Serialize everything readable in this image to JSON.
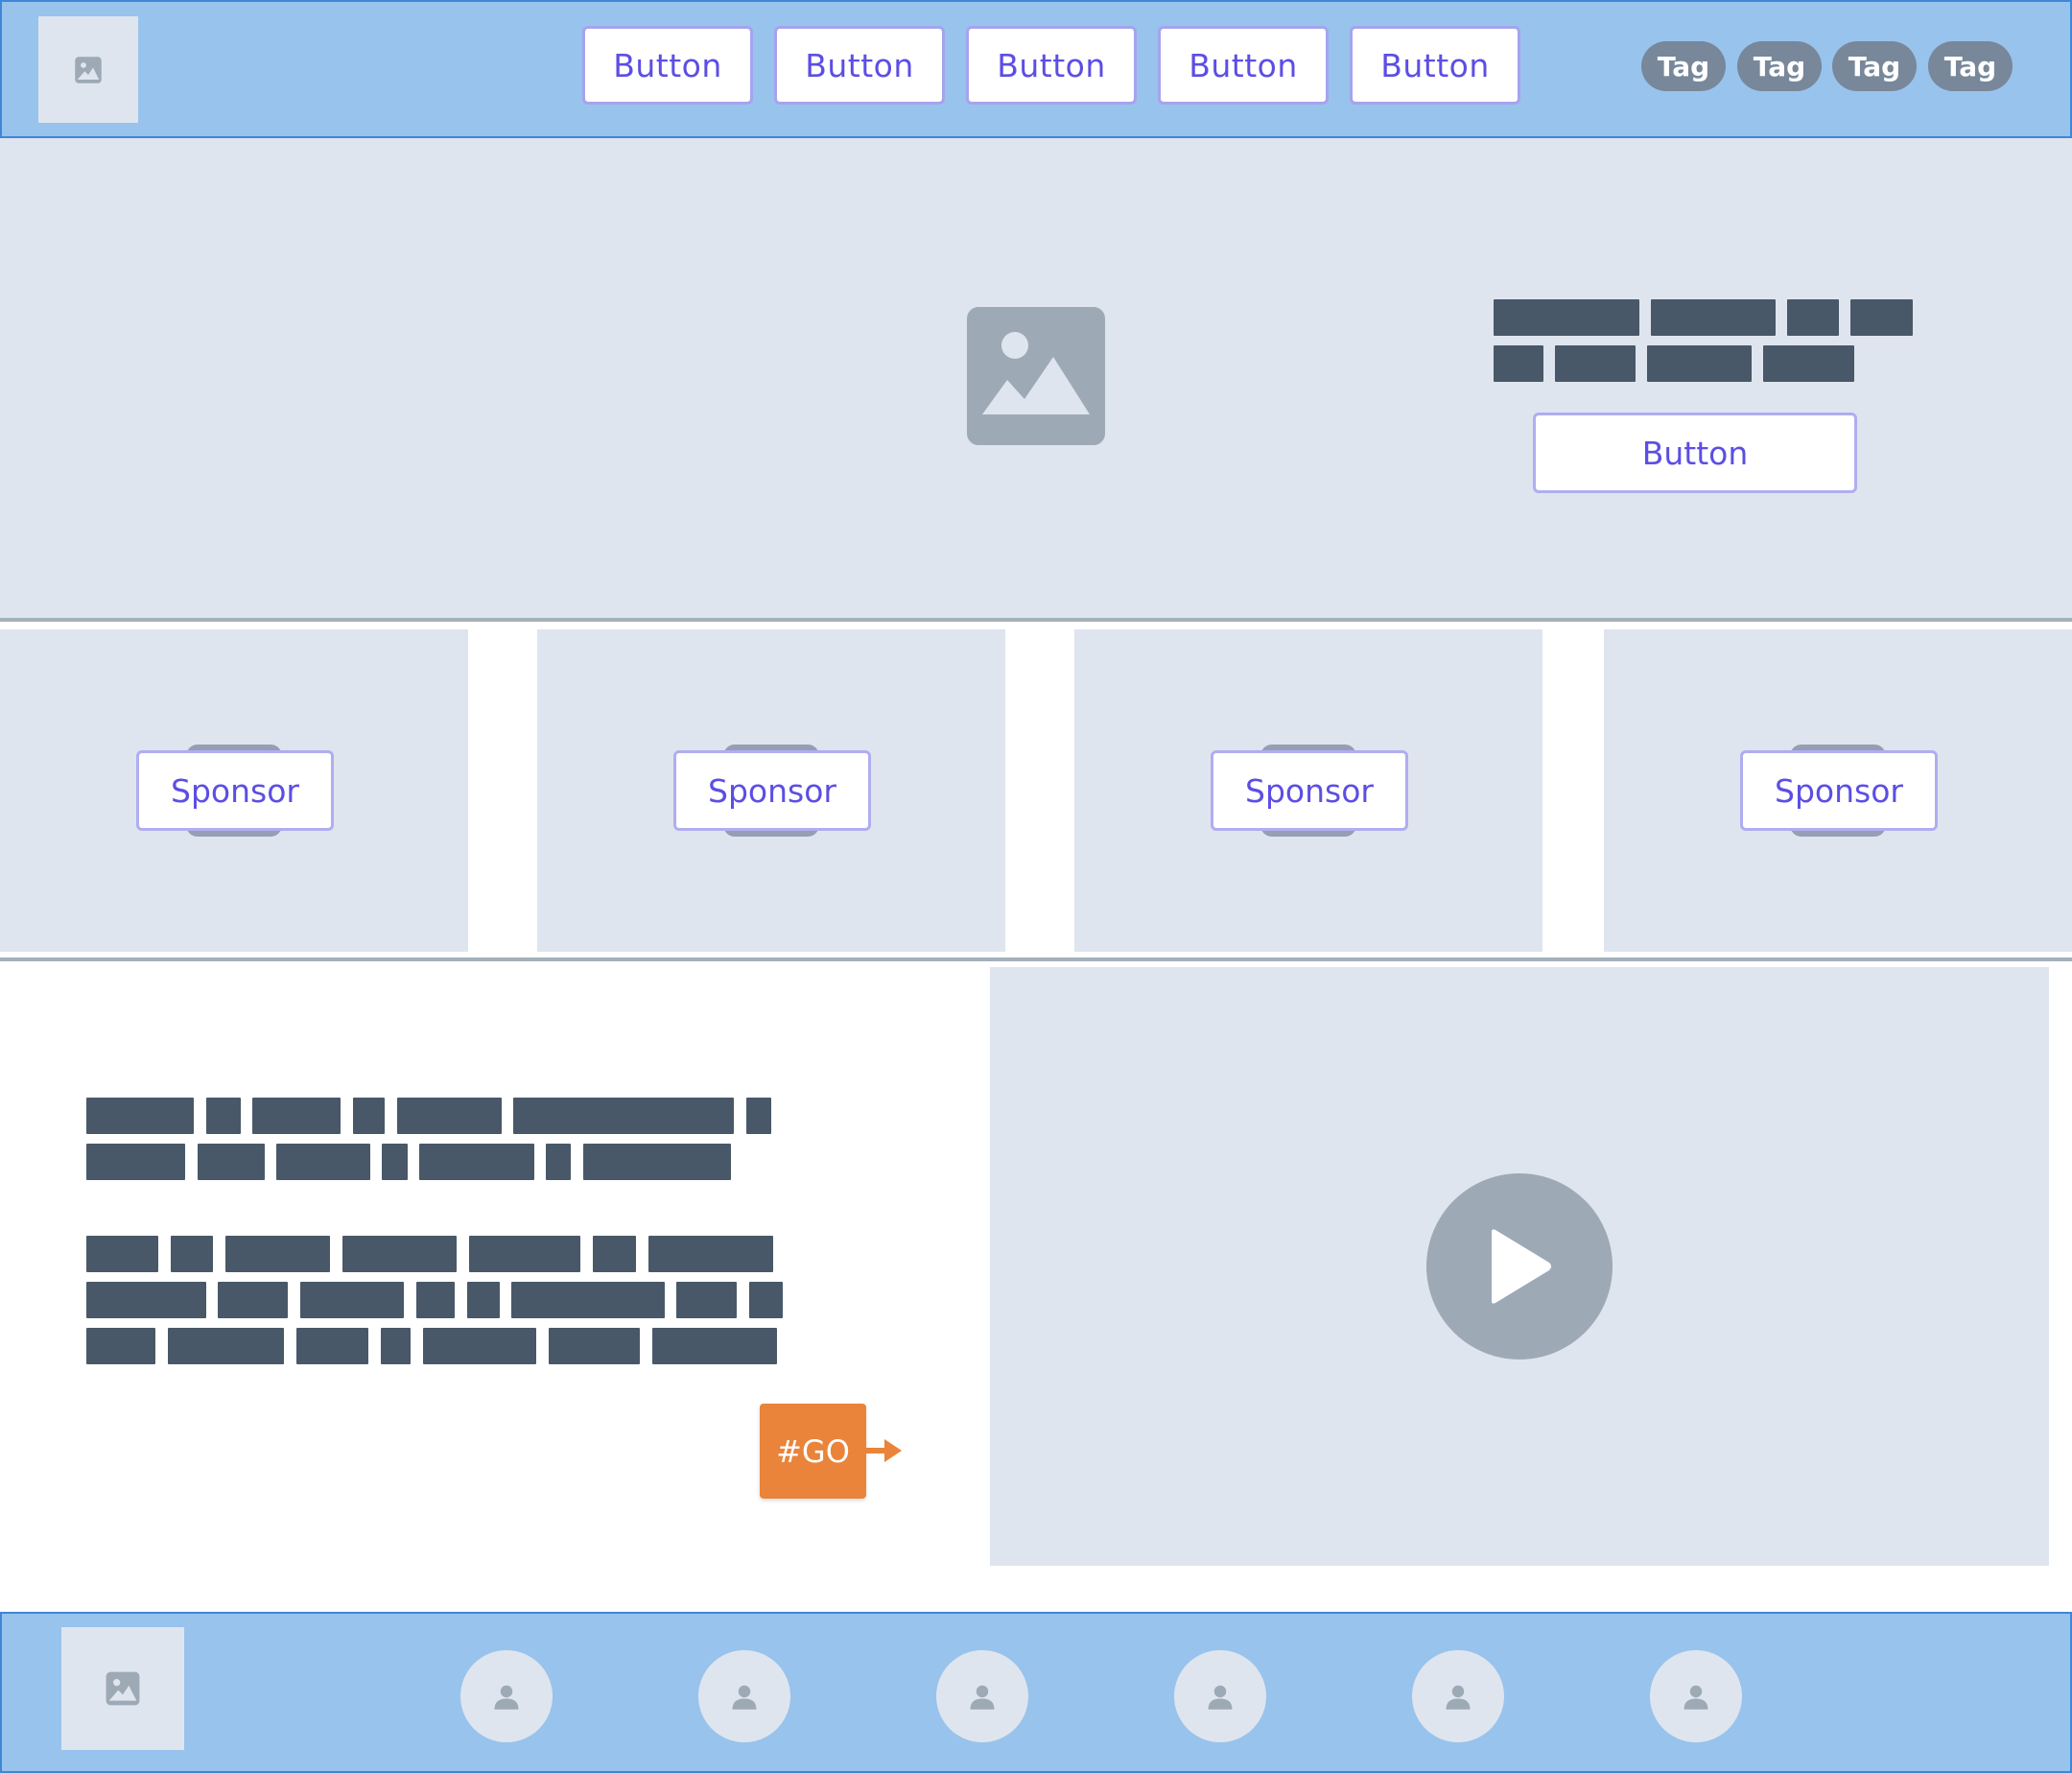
{
  "header": {
    "logo_icon": "image-icon",
    "nav_buttons": [
      "Button",
      "Button",
      "Button",
      "Button",
      "Button"
    ],
    "tags": [
      "Tag",
      "Tag",
      "Tag",
      "Tag"
    ]
  },
  "hero": {
    "image_icon": "image-icon",
    "cta_label": "Button"
  },
  "sponsors": {
    "items": [
      "Sponsor",
      "Sponsor",
      "Sponsor",
      "Sponsor"
    ]
  },
  "content": {
    "go_label": "#GO",
    "video_icon": "play-icon"
  },
  "footer": {
    "logo_icon": "image-icon",
    "avatar_icon": "user-icon",
    "avatar_count": 6
  },
  "colors": {
    "header_bg": "#98c3ec",
    "header_border": "#3f86d8",
    "panel_bg": "#dfe5ee",
    "button_text": "#5c4ee4",
    "button_border": "#a6a3ee",
    "tag_bg": "#78879a",
    "text_bar": "#485868",
    "accent_orange": "#e9843a",
    "icon_gray": "#9daab6"
  }
}
